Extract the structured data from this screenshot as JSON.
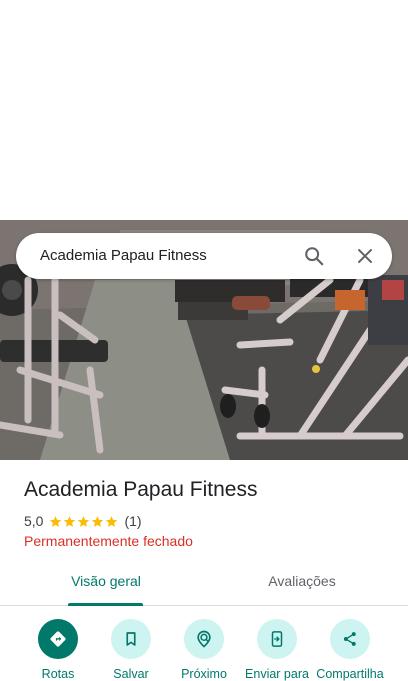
{
  "search": {
    "query": "Academia Papau Fitness"
  },
  "photo": {
    "subject": "gym interior"
  },
  "place": {
    "name": "Academia Papau Fitness",
    "rating": "5,0",
    "stars": 5,
    "review_count": "(1)",
    "status": "Permanentemente fechado",
    "status_color": "#d93025"
  },
  "tabs": [
    {
      "label": "Visão geral",
      "active": true
    },
    {
      "label": "Avaliações",
      "active": false
    }
  ],
  "actions": [
    {
      "label": "Rotas",
      "icon": "directions-icon"
    },
    {
      "label": "Salvar",
      "icon": "bookmark-icon"
    },
    {
      "label": "Próximo",
      "icon": "nearby-icon"
    },
    {
      "label": "Enviar para",
      "icon": "send-to-phone-icon"
    },
    {
      "label": "Compartilha",
      "icon": "share-icon"
    }
  ],
  "colors": {
    "accent": "#00796b",
    "accent_light": "#cdf4f0",
    "star": "#fbbc04"
  }
}
